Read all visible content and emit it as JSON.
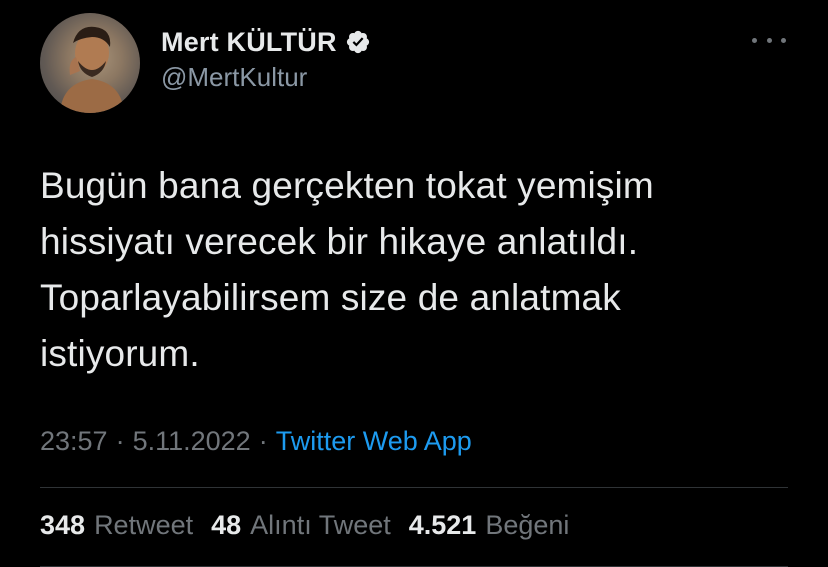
{
  "author": {
    "display_name": "Mert KÜLTÜR",
    "handle": "@MertKultur",
    "verified": true,
    "avatar_icon": "profile-photo"
  },
  "tweet": {
    "text": "Bugün bana gerçekten tokat yemişim\nhissiyatı verecek bir hikaye anlatıldı.\nToparlayabilirsem size de anlatmak\nistiyorum."
  },
  "meta": {
    "time": "23:57",
    "separator": "·",
    "date": "5.11.2022",
    "source": "Twitter Web App"
  },
  "stats": {
    "retweets": {
      "count": "348",
      "label": "Retweet"
    },
    "quotes": {
      "count": "48",
      "label": "Alıntı Tweet"
    },
    "likes": {
      "count": "4.521",
      "label": "Beğeni"
    }
  },
  "colors": {
    "background": "#000000",
    "text": "#e7e9ea",
    "secondary": "#71767b",
    "accent": "#1d9bf0"
  },
  "icons": {
    "more": "more-horizontal-icon",
    "verified": "verified-badge-icon"
  }
}
